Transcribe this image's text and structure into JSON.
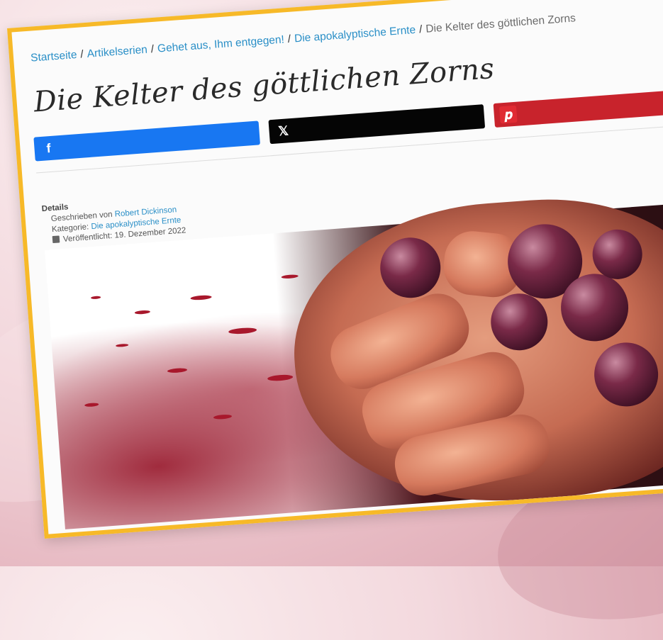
{
  "breadcrumb": {
    "items": [
      "Startseite",
      "Artikelserien",
      "Gehet aus, Ihm entgegen!",
      "Die apokalyptische Ernte"
    ],
    "current": "Die Kelter des göttlichen Zorns",
    "separator": "/"
  },
  "article": {
    "title": "Die Kelter des göttlichen Zorns"
  },
  "share": {
    "facebook_icon": "f",
    "x_icon": "𝕏",
    "pinterest_icon": "𝒑"
  },
  "details": {
    "label": "Details",
    "author_prefix": "Geschrieben von",
    "author": "Robert Dickinson",
    "category_prefix": "Kategorie:",
    "category": "Die apokalyptische Ernte",
    "published": "Veröffentlicht: 19. Dezember 2022"
  },
  "colors": {
    "frame": "#f7b928",
    "link": "#2a8fc7",
    "facebook": "#1877f2",
    "x": "#050505",
    "pinterest": "#c8232c"
  }
}
